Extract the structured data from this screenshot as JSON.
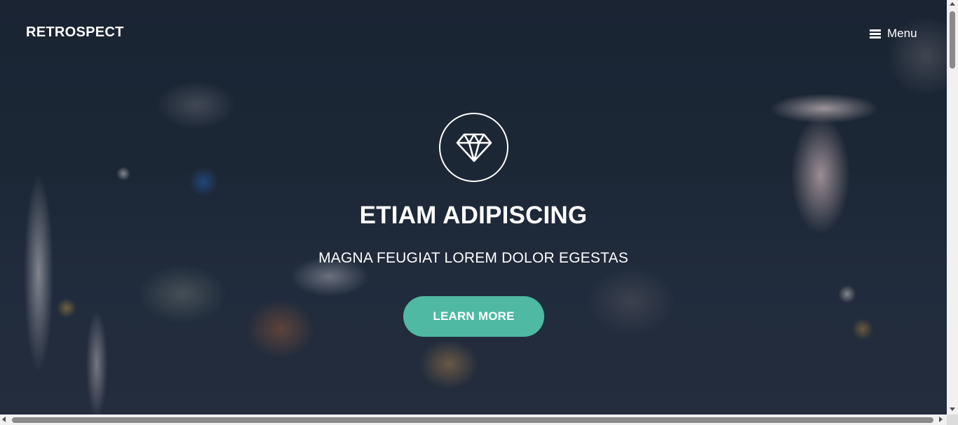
{
  "header": {
    "brand": "RETROSPECT",
    "menu_label": "Menu",
    "menu_icon": "hamburger-icon"
  },
  "hero": {
    "icon": "diamond-icon",
    "title": "ETIAM ADIPISCING",
    "subtitle": "MAGNA FEUGIAT LOREM DOLOR EGESTAS",
    "button_label": "LEARN MORE"
  },
  "colors": {
    "accent": "#4fb9a3",
    "background": "#1b2736",
    "text": "#ffffff"
  }
}
